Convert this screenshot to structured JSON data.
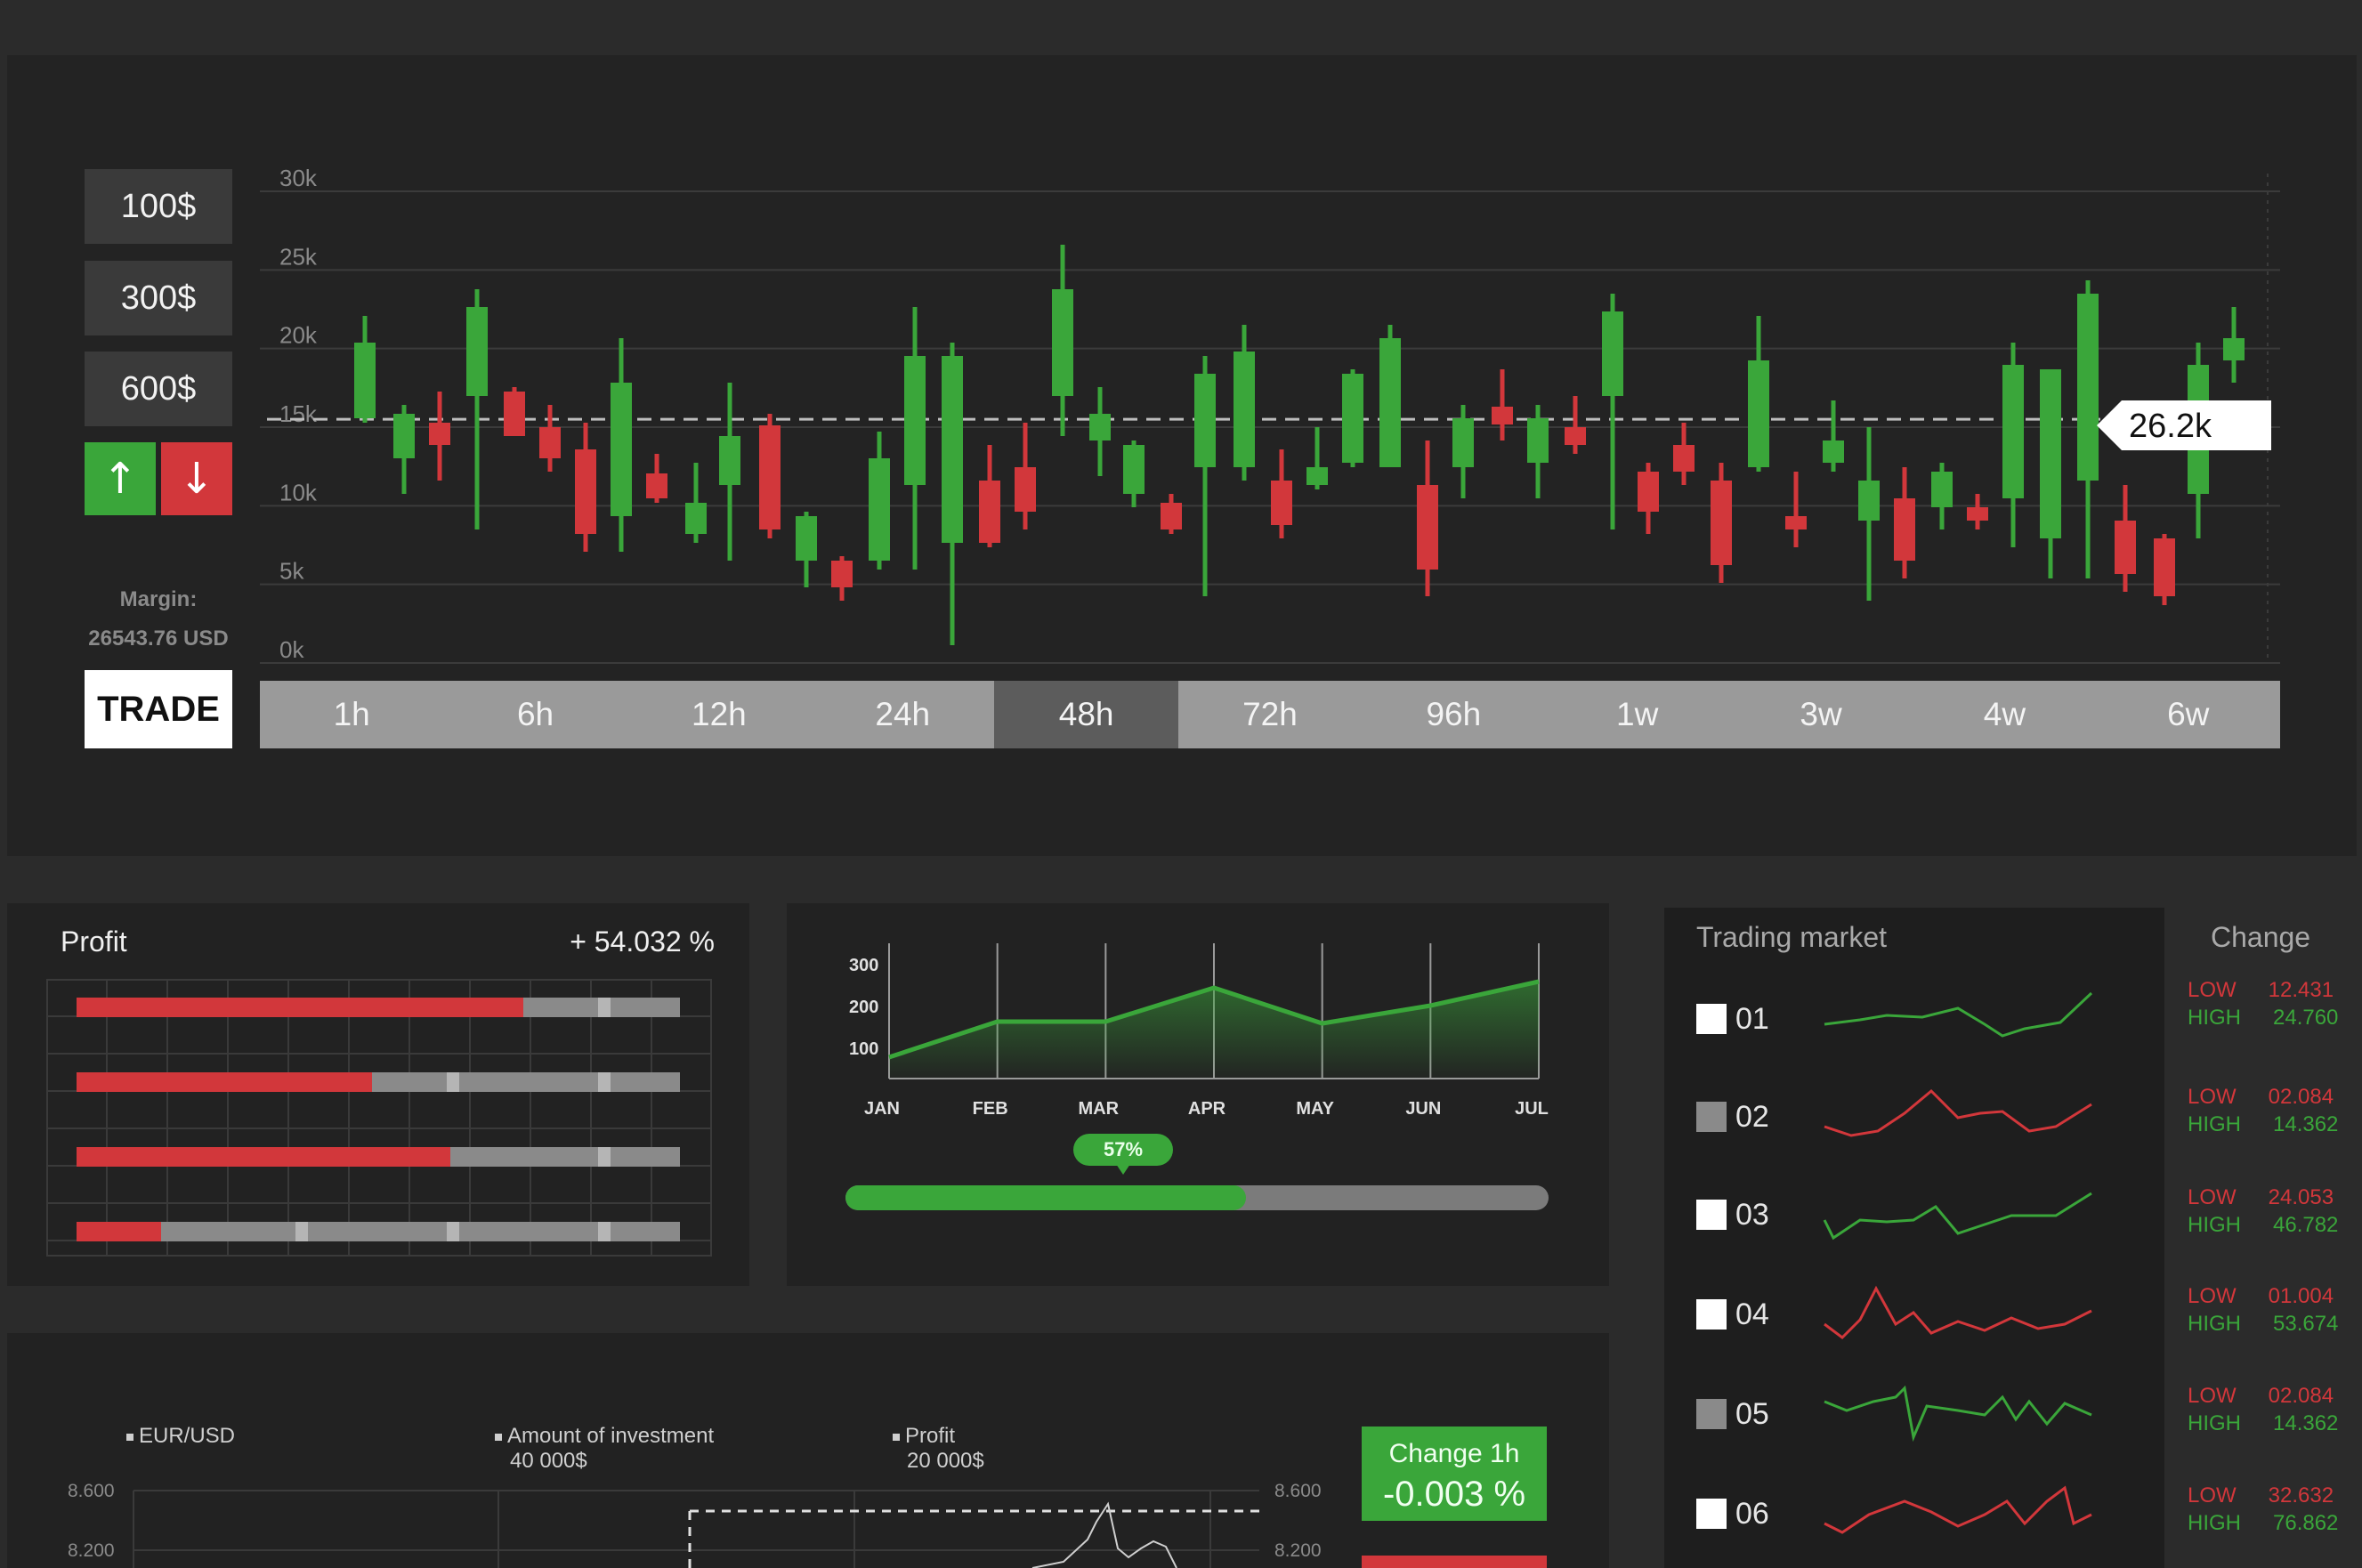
{
  "amounts": [
    "100$",
    "300$",
    "600$"
  ],
  "direction": {
    "up_symbol": "↑",
    "down_symbol": "↓",
    "up_color": "#3aa63a",
    "down_color": "#d2373b"
  },
  "margin": {
    "label": "Margin:",
    "value": "26543.76 USD"
  },
  "trade_label": "TRADE",
  "main_chart": {
    "y_ticks": [
      "30k",
      "25k",
      "20k",
      "15k",
      "10k",
      "5k",
      "0k"
    ],
    "current_value": "26.2k",
    "timeframes": [
      "1h",
      "6h",
      "12h",
      "24h",
      "48h",
      "72h",
      "96h",
      "1w",
      "3w",
      "4w",
      "6w"
    ],
    "active_timeframe": "48h"
  },
  "profit": {
    "title": "Profit",
    "value": "+ 54.032 %",
    "bars": [
      0.74,
      0.49,
      0.62,
      0.14
    ]
  },
  "monthly": {
    "y_ticks": [
      "300",
      "200",
      "100"
    ],
    "months": [
      "JAN",
      "FEB",
      "MAR",
      "APR",
      "MAY",
      "JUN",
      "JUL"
    ],
    "progress_label": "57%",
    "progress": 0.57
  },
  "bottom": {
    "legend_1": "EUR/USD",
    "legend_2": "Amount of investment",
    "legend_2_value": "40 000$",
    "legend_3": "Profit",
    "legend_3_value": "20 000$",
    "y_left": [
      "8.600",
      "8.200"
    ],
    "y_right": [
      "8.600",
      "8.200"
    ],
    "change_label": "Change 1h",
    "change_value": "-0.003 %"
  },
  "market": {
    "title": "Trading market",
    "change_title": "Change",
    "low_label": "LOW",
    "high_label": "HIGH",
    "rows": [
      {
        "id": "01",
        "low": "12.431",
        "high": "24.760",
        "color": "#3aa63a",
        "swatch": "#ffffff"
      },
      {
        "id": "02",
        "low": "02.084",
        "high": "14.362",
        "color": "#d2373b",
        "swatch": "#8a8a8a"
      },
      {
        "id": "03",
        "low": "24.053",
        "high": "46.782",
        "color": "#3aa63a",
        "swatch": "#ffffff"
      },
      {
        "id": "04",
        "low": "01.004",
        "high": "53.674",
        "color": "#d2373b",
        "swatch": "#ffffff"
      },
      {
        "id": "05",
        "low": "02.084",
        "high": "14.362",
        "color": "#3aa63a",
        "swatch": "#8a8a8a"
      },
      {
        "id": "06",
        "low": "32.632",
        "high": "76.862",
        "color": "#d2373b",
        "swatch": "#ffffff"
      }
    ]
  }
}
